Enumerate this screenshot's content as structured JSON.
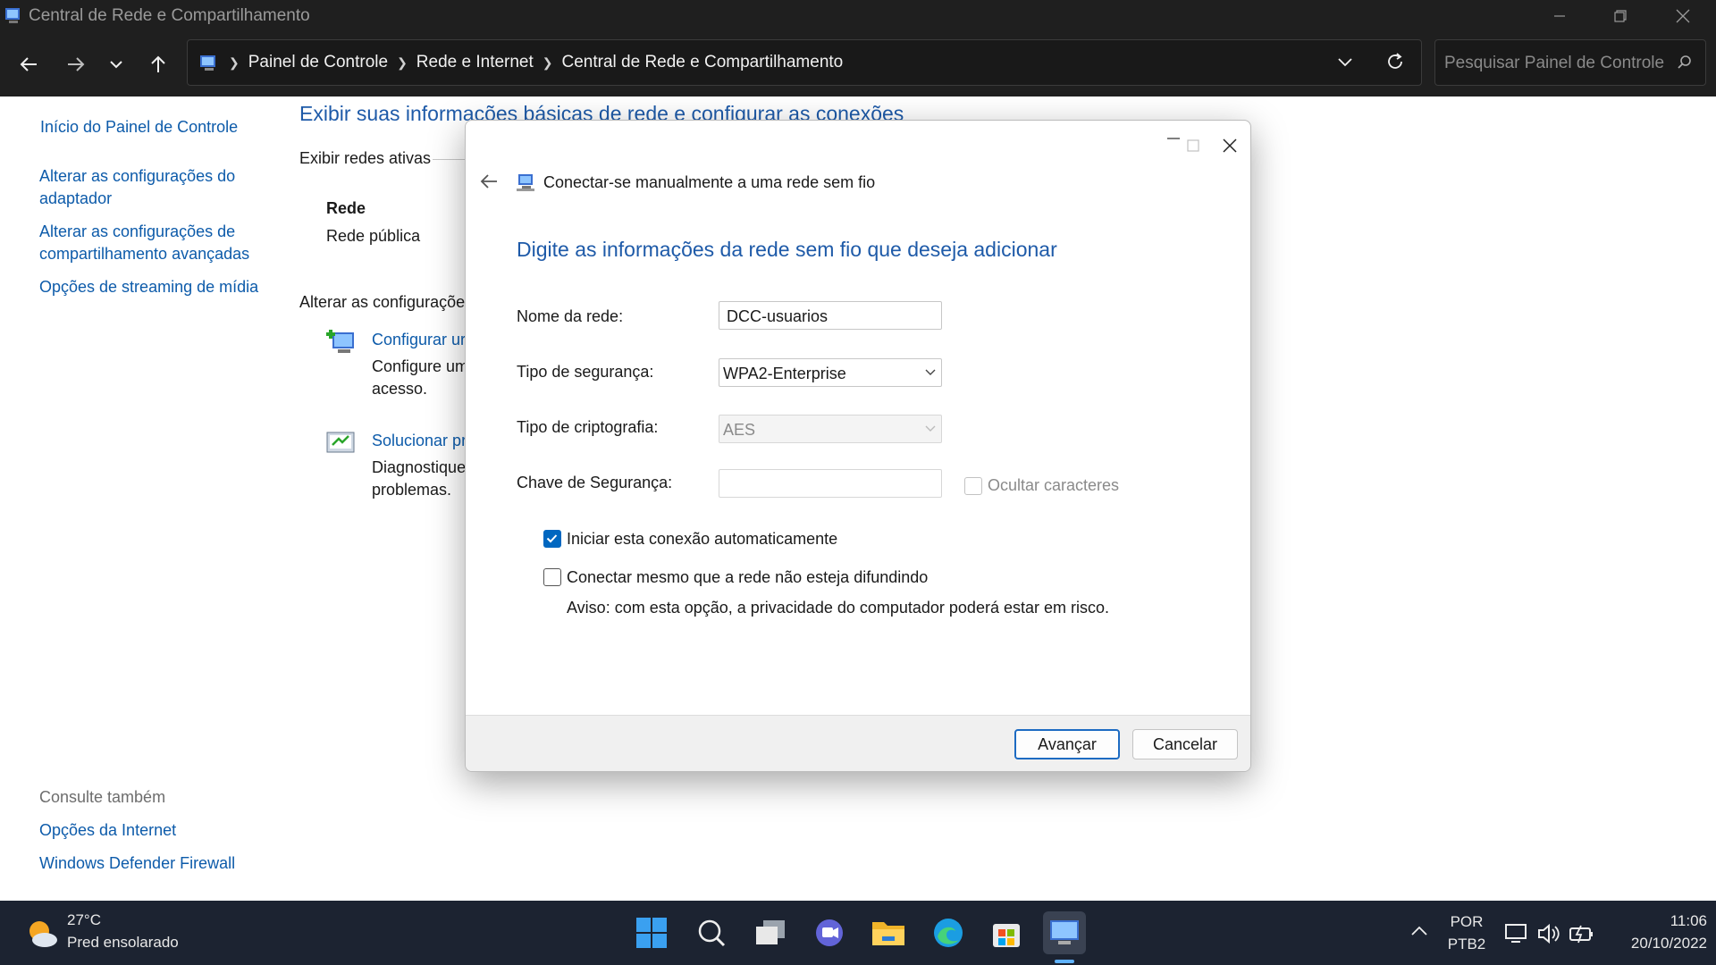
{
  "window": {
    "title": "Central de Rede e Compartilhamento",
    "breadcrumb": [
      "Painel de Controle",
      "Rede e Internet",
      "Central de Rede e Compartilhamento"
    ],
    "search_placeholder": "Pesquisar Painel de Controle"
  },
  "sidebar": {
    "home": "Início do Painel de Controle",
    "items": [
      {
        "line1": "Alterar as configurações do",
        "line2": "adaptador"
      },
      {
        "line1": "Alterar as configurações de",
        "line2": "compartilhamento avançadas"
      },
      {
        "line1": "Opções de streaming de mídia",
        "line2": ""
      }
    ],
    "see_also_title": "Consulte também",
    "see_also": [
      "Opções da Internet",
      "Windows Defender Firewall"
    ]
  },
  "main": {
    "heading": "Exibir suas informações básicas de rede e configurar as conexões",
    "active_networks": "Exibir redes ativas",
    "network_name": "Rede",
    "network_type": "Rede pública",
    "change_settings": "Alterar as configurações",
    "task1_link": "Configurar ur",
    "task1_desc1": "Configure um",
    "task1_desc2": "acesso.",
    "task2_link": "Solucionar pr",
    "task2_desc1": "Diagnostique",
    "task2_desc2": "problemas."
  },
  "dialog": {
    "title": "Conectar-se manualmente a uma rede sem fio",
    "heading": "Digite as informações da rede sem fio que deseja adicionar",
    "network_name_label": "Nome da rede:",
    "network_name_value": "DCC-usuarios",
    "security_type_label": "Tipo de segurança:",
    "security_type_value": "WPA2-Enterprise",
    "encryption_label": "Tipo de criptografia:",
    "encryption_value": "AES",
    "key_label": "Chave de Segurança:",
    "key_value": "",
    "hide_chars_label": "Ocultar caracteres",
    "hide_chars_checked": false,
    "auto_start_label": "Iniciar esta conexão automaticamente",
    "auto_start_checked": true,
    "connect_hidden_label": "Conectar mesmo que a rede não esteja difundindo",
    "connect_hidden_checked": false,
    "warning": "Aviso: com esta opção, a privacidade do computador poderá estar em risco.",
    "next_button": "Avançar",
    "cancel_button": "Cancelar"
  },
  "taskbar": {
    "weather_temp": "27°C",
    "weather_desc": "Pred ensolarado",
    "lang1": "POR",
    "lang2": "PTB2",
    "time": "11:06",
    "date": "20/10/2022",
    "icons": [
      "start-icon",
      "search-icon",
      "task-view-icon",
      "chat-icon",
      "file-explorer-icon",
      "edge-icon",
      "store-icon",
      "control-panel-icon"
    ]
  },
  "colors": {
    "accent": "#0067c0",
    "link": "#0d5baa",
    "heading": "#1e5aa8",
    "taskbar": "#1c2331",
    "titlebar": "#1f1f1f"
  }
}
